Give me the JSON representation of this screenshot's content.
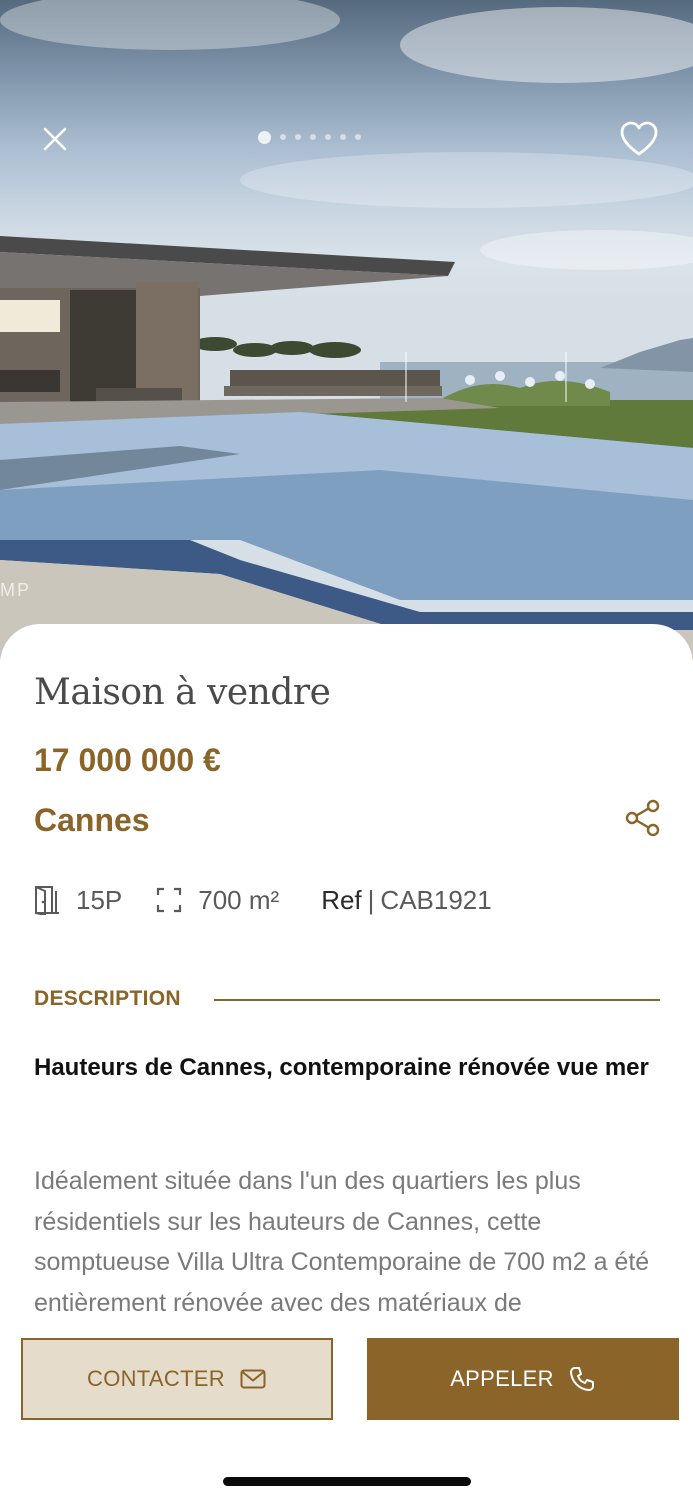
{
  "header": {
    "close_icon": "close-icon",
    "favorite_icon": "heart-icon",
    "carousel": {
      "count": 7,
      "active_index": 0
    },
    "watermark": "MP"
  },
  "listing": {
    "title": "Maison à vendre",
    "price": "17 000 000 €",
    "city": "Cannes",
    "share_icon": "share-icon",
    "specs": {
      "rooms": "15P",
      "area": "700 m²",
      "ref_label": "Ref",
      "ref_separator": "|",
      "ref_value": "CAB1921"
    },
    "description_heading": "DESCRIPTION",
    "description_title": "Hauteurs de Cannes, contemporaine rénovée vue mer",
    "description_body": "Idéalement située dans l'un des quartiers les plus résidentiels sur les hauteurs de Cannes, cette somptueuse Villa Ultra Contemporaine de 700 m2 a été entièrement rénovée avec des matériaux de"
  },
  "actions": {
    "contact_label": "CONTACTER",
    "contact_icon": "mail-icon",
    "call_label": "APPELER",
    "call_icon": "phone-icon"
  },
  "colors": {
    "accent": "#8a6428",
    "contact_bg": "#e6dccb",
    "title_text": "#4a4a4a",
    "body_text": "#7a7a7a"
  }
}
